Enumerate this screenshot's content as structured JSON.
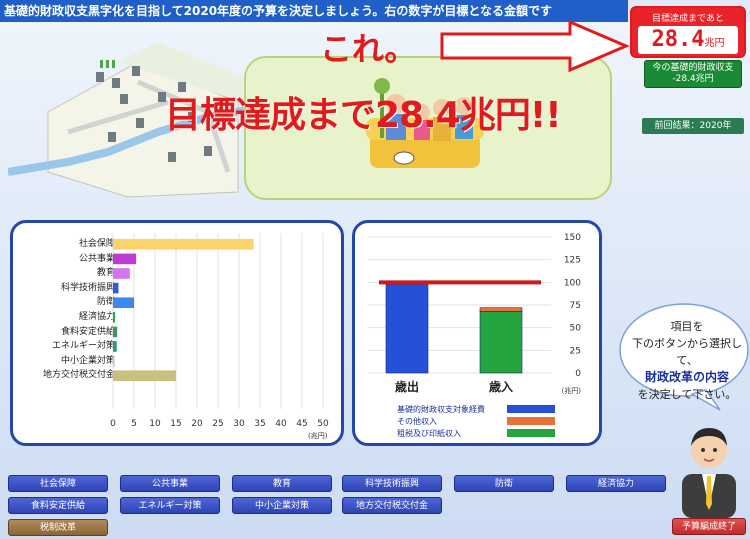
{
  "header": {
    "instruction": "基礎的財政収支黒字化を目指して2020年度の予算を決定しましょう。右の数字が目標となる金額です"
  },
  "status": {
    "goal_label": "目標達成まであと",
    "goal_value": "28.4",
    "goal_unit": "兆円",
    "balance_label": "今の基礎的財政収支",
    "balance_value": "-28.4",
    "balance_unit": "兆円",
    "prev_result": "前回結果：2020年"
  },
  "annotations": {
    "kore": "これ。",
    "goal_message": "目標達成まで28.4兆円!!"
  },
  "bubble": {
    "line1": "項目を",
    "line2": "下のボタンから選択して、",
    "line3": "財政改革の内容",
    "line4": "を決定して下さい。"
  },
  "colors": {
    "header_blue": "#1f5fc7",
    "panel_border": "#2547a8",
    "goal_red": "#e8232a",
    "balance_green": "#1a8a35",
    "button_blue": "#3a4fc2"
  },
  "left_chart": {
    "type": "bar",
    "orientation": "horizontal",
    "categories": [
      "社会保障",
      "公共事業",
      "教育",
      "科学技術振興",
      "防衛",
      "経済協力",
      "食料安定供給",
      "エネルギー対策",
      "中小企業対策",
      "地方交付税交付金"
    ],
    "values": [
      33.5,
      5.5,
      4,
      1.3,
      5,
      0.5,
      1,
      0.9,
      0.2,
      15
    ],
    "colors": [
      "#fbd36b",
      "#c13ad6",
      "#d474f0",
      "#2e5bd9",
      "#3c88ee",
      "#1fae4e",
      "#3b9a5a",
      "#2aa07a",
      "#bfbfbf",
      "#c8c07e"
    ],
    "xlim": [
      0,
      50
    ],
    "xticks": [
      "0",
      "5",
      "10",
      "15",
      "20",
      "25",
      "30",
      "35",
      "40",
      "45",
      "50"
    ],
    "unit": "(兆円)"
  },
  "right_chart": {
    "type": "bar",
    "categories": [
      "歳出",
      "歳入"
    ],
    "series": [
      {
        "name": "基礎的財政収支対象経費",
        "color": "#2750d8",
        "values": [
          98,
          0
        ]
      },
      {
        "name": "その他収入",
        "color": "#e8713a",
        "values": [
          0,
          4
        ]
      },
      {
        "name": "租税及び印紙収入",
        "color": "#24a53f",
        "values": [
          0,
          68
        ]
      }
    ],
    "target_line": 100,
    "ylim": [
      0,
      150
    ],
    "yticks": [
      "150",
      "125",
      "100",
      "75",
      "50",
      "25",
      "0"
    ],
    "unit": "(兆円)"
  },
  "buttons": {
    "row1": [
      "社会保障",
      "公共事業",
      "教育",
      "科学技術振興",
      "防衛",
      "経済協力"
    ],
    "row2": [
      "食料安定供給",
      "エネルギー対策",
      "中小企業対策",
      "地方交付税交付金"
    ],
    "tax": "税制改革",
    "end": "予算編成終了"
  }
}
